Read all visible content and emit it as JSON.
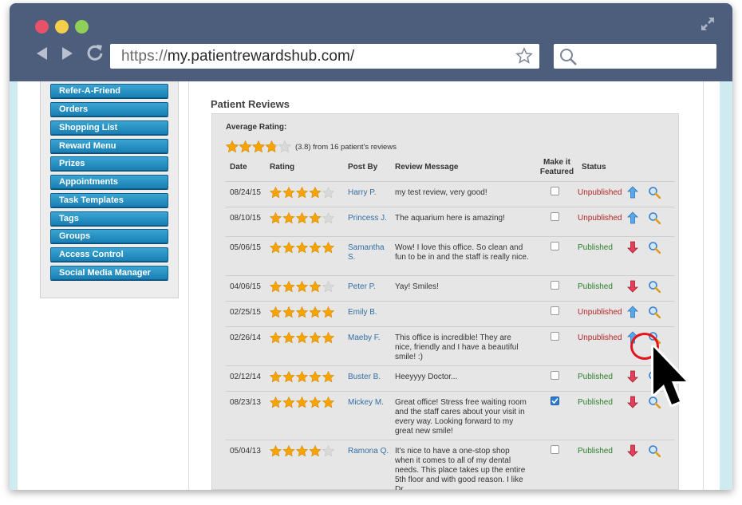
{
  "browser": {
    "url_protocol": "https://",
    "url_host": "my.patientrewardshub.com/"
  },
  "sidebar": {
    "items": [
      {
        "label": "Refer-A-Friend"
      },
      {
        "label": "Orders"
      },
      {
        "label": "Shopping List"
      },
      {
        "label": "Reward Menu"
      },
      {
        "label": "Prizes"
      },
      {
        "label": "Appointments"
      },
      {
        "label": "Task Templates"
      },
      {
        "label": "Tags"
      },
      {
        "label": "Groups"
      },
      {
        "label": "Access Control"
      },
      {
        "label": "Social Media Manager"
      }
    ]
  },
  "reviews": {
    "title": "Patient Reviews",
    "average_label": "Average Rating:",
    "average_value": 3.8,
    "average_text": "(3.8) from 16 patient's reviews",
    "headers": {
      "date": "Date",
      "rating": "Rating",
      "post_by": "Post By",
      "message": "Review Message",
      "featured_line1": "Make it",
      "featured_line2": "Featured",
      "status": "Status"
    },
    "rows": [
      {
        "date": "08/24/15",
        "rating": 4,
        "post_by": "Harry P.",
        "message": "my test review, very good!",
        "featured": false,
        "status": "Unpublished"
      },
      {
        "date": "08/10/15",
        "rating": 4,
        "post_by": "Princess J.",
        "message": "The aquarium here is amazing!",
        "featured": false,
        "status": "Unpublished"
      },
      {
        "date": "05/06/15",
        "rating": 5,
        "post_by": "Samantha S.",
        "message": "Wow! I love this office. So clean and fun to be in and the staff is really nice.",
        "featured": false,
        "status": "Published"
      },
      {
        "date": "04/06/15",
        "rating": 4,
        "post_by": "Peter P.",
        "message": "Yay! Smiles!",
        "featured": false,
        "status": "Published"
      },
      {
        "date": "02/25/15",
        "rating": 5,
        "post_by": "Emily B.",
        "message": "",
        "featured": false,
        "status": "Unpublished"
      },
      {
        "date": "02/26/14",
        "rating": 5,
        "post_by": "Maeby F.",
        "message": "This office is incredible! They are nice, friendly and I have a beautiful smile! :)",
        "featured": false,
        "status": "Unpublished"
      },
      {
        "date": "02/12/14",
        "rating": 5,
        "post_by": "Buster B.",
        "message": "Heeyyyy Doctor...",
        "featured": false,
        "status": "Published"
      },
      {
        "date": "08/23/13",
        "rating": 5,
        "post_by": "Mickey M.",
        "message": "Great office! Stress free waiting room and the staff cares about your visit in every way. Looking forward to my great new smile!",
        "featured": true,
        "status": "Published"
      },
      {
        "date": "05/04/13",
        "rating": 4,
        "post_by": "Ramona Q.",
        "message": "It's nice to have a one-stop shop when it comes to all of my dental needs. This place takes up the entire 5th floor and with good reason. I like Dr.",
        "featured": false,
        "status": "Published"
      }
    ]
  },
  "colors": {
    "chrome": "#4d5d7c",
    "menu_button": "#1a7fb4",
    "star": "#f7a400",
    "published": "#2a7f2a",
    "unpublished": "#b32424",
    "link": "#336ea3",
    "highlight_ring": "#e3141b"
  },
  "icons": {
    "window_close": "red-dot",
    "window_minimize": "yellow-dot",
    "window_zoom": "green-dot",
    "expand": "expand-arrows-icon",
    "back": "back-arrow-icon",
    "forward": "forward-arrow-icon",
    "reload": "reload-icon",
    "bookmark": "star-outline-icon",
    "search": "magnifier-icon",
    "publish": "up-arrow-blue-icon",
    "unpublish": "down-arrow-red-icon",
    "view": "zoom-magnifier-icon",
    "cursor": "mouse-pointer-icon"
  }
}
